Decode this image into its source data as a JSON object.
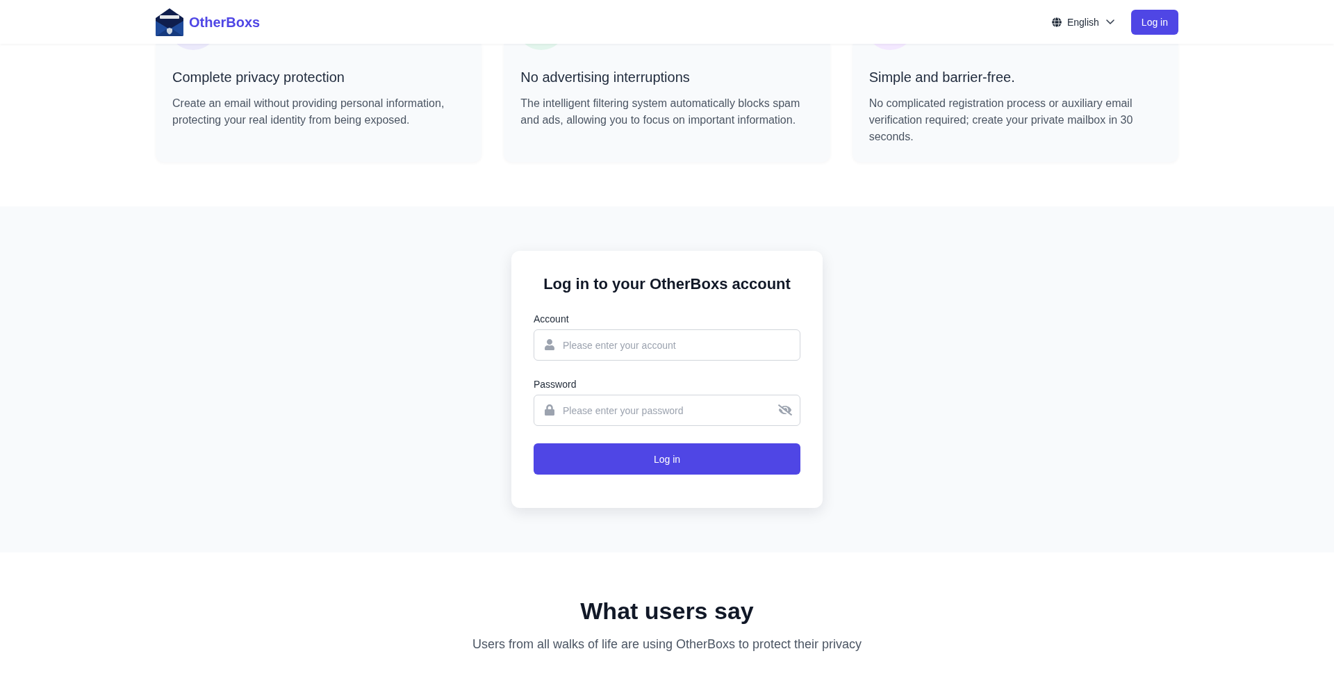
{
  "header": {
    "brand": "OtherBoxs",
    "language": "English",
    "login_button": "Log in"
  },
  "features": [
    {
      "title": "Complete privacy protection",
      "description": "Create an email without providing personal information, protecting your real identity from being exposed.",
      "color": "#ebe9fb"
    },
    {
      "title": "No advertising interruptions",
      "description": "The intelligent filtering system automatically blocks spam and ads, allowing you to focus on important information.",
      "color": "#e2f5ec"
    },
    {
      "title": "Simple and barrier-free.",
      "description": "No complicated registration process or auxiliary email verification required; create your private mailbox in 30 seconds.",
      "color": "#f3e8ff"
    }
  ],
  "login_form": {
    "title": "Log in to your OtherBoxs account",
    "fields": [
      {
        "kind": "account",
        "label": "Account",
        "placeholder": "Please enter your account"
      },
      {
        "kind": "password",
        "label": "Password",
        "placeholder": "Please enter your password"
      }
    ],
    "submit": "Log in"
  },
  "testimonials": {
    "title": "What users say",
    "subtitle": "Users from all walks of life are using OtherBoxs to protect their privacy"
  }
}
